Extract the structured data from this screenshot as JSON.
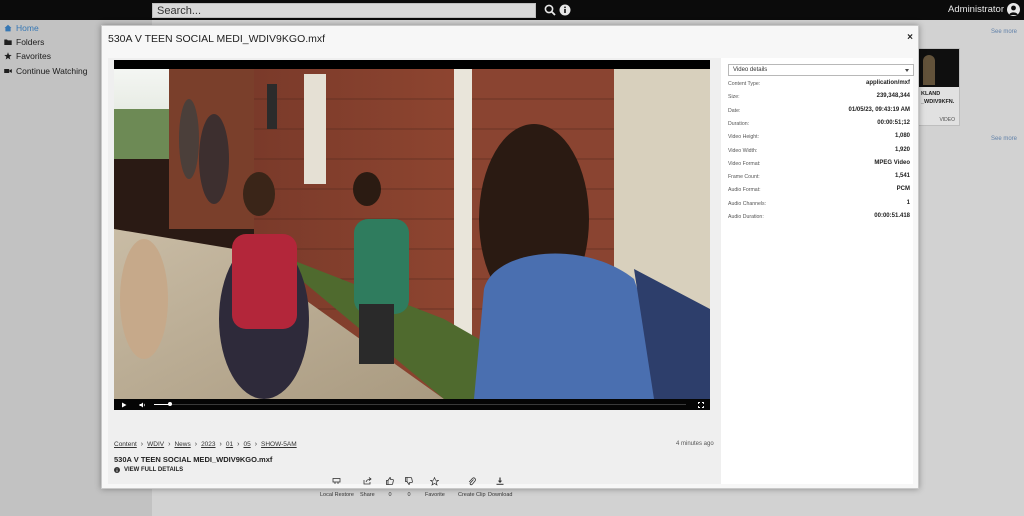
{
  "topbar": {
    "search_placeholder": "Search...",
    "user_name": "Administrator"
  },
  "sidebar": {
    "items": [
      {
        "label": "Home",
        "icon": "home-icon"
      },
      {
        "label": "Folders",
        "icon": "folder-icon"
      },
      {
        "label": "Favorites",
        "icon": "star-icon"
      },
      {
        "label": "Continue Watching",
        "icon": "video-camera-icon"
      }
    ]
  },
  "background": {
    "see_more_1": "See more",
    "see_more_2": "See more",
    "card_title_1": "KLAND",
    "card_title_2": "_WDIV9KFN.",
    "card_type": "VIDEO"
  },
  "modal": {
    "title": "530A V TEEN SOCIAL MEDI_WDIV9KGO.mxf",
    "close": "×",
    "breadcrumb": [
      "Content",
      "WDIV",
      "News",
      "2023",
      "01",
      "05",
      "SHOW-5AM"
    ],
    "time_ago": "4 minutes ago",
    "file_name": "530A V TEEN SOCIAL MEDI_WDIV9KGO.mxf",
    "view_details": "VIEW FULL DETAILS",
    "actions": [
      {
        "label": "Local Restore",
        "icon": "restore-icon"
      },
      {
        "label": "Share",
        "icon": "share-icon"
      },
      {
        "label": "0",
        "icon": "thumbs-up-icon"
      },
      {
        "label": "0",
        "icon": "thumbs-down-icon"
      },
      {
        "label": "Favorite",
        "icon": "star-outline-icon"
      },
      {
        "label": "Create Clip",
        "icon": "paperclip-icon"
      },
      {
        "label": "Download",
        "icon": "download-icon"
      }
    ],
    "player": {
      "progress": 0.03
    },
    "details": {
      "select_label": "Video details",
      "rows": [
        {
          "key": "Content Type:",
          "value": "application/mxf"
        },
        {
          "key": "Size:",
          "value": "239,348,344"
        },
        {
          "key": "Date:",
          "value": "01/05/23, 09:43:19 AM"
        },
        {
          "key": "Duration:",
          "value": "00:00:51;12"
        },
        {
          "key": "Video Height:",
          "value": "1,080"
        },
        {
          "key": "Video Width:",
          "value": "1,920"
        },
        {
          "key": "Video Format:",
          "value": "MPEG Video"
        },
        {
          "key": "Frame Count:",
          "value": "1,541"
        },
        {
          "key": "Audio Format:",
          "value": "PCM"
        },
        {
          "key": "Audio Channels:",
          "value": "1"
        },
        {
          "key": "Audio Duration:",
          "value": "00:00:51.418"
        }
      ]
    }
  }
}
